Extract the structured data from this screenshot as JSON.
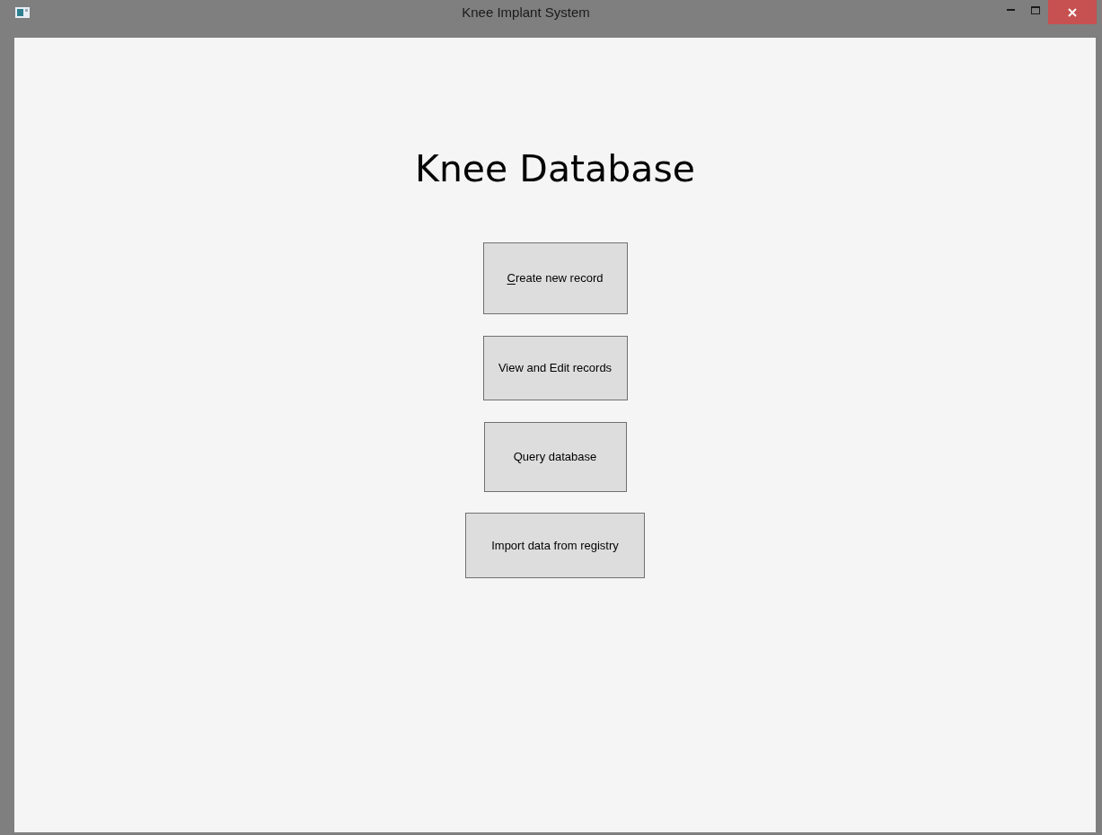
{
  "window": {
    "title": "Knee Implant System"
  },
  "heading": "Knee Database",
  "buttons": [
    {
      "label": "Create new record",
      "mnemonic": true
    },
    {
      "label": "View and Edit records",
      "mnemonic": false
    },
    {
      "label": "Query database",
      "mnemonic": false
    },
    {
      "label": "Import data from registry",
      "mnemonic": false
    }
  ]
}
